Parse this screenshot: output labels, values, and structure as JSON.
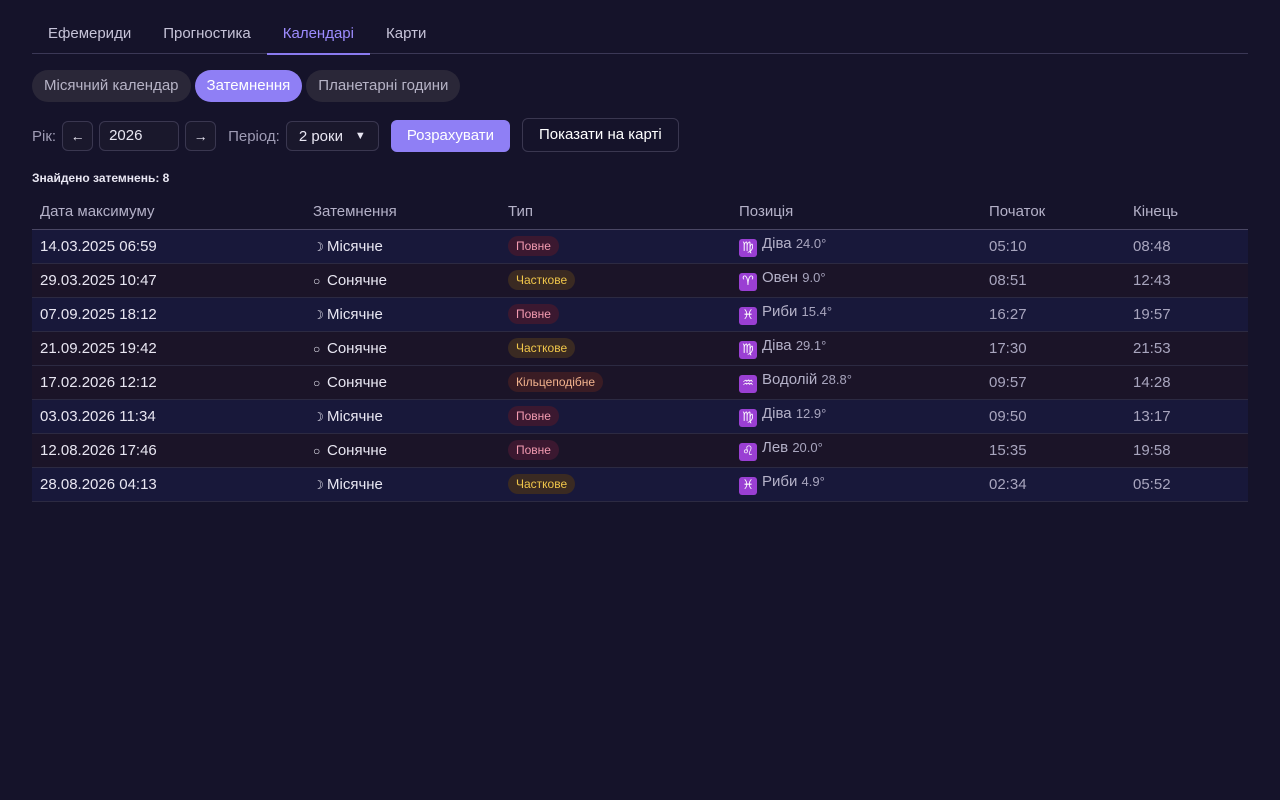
{
  "tabs": [
    {
      "label": "Ефемериди",
      "active": false
    },
    {
      "label": "Прогностика",
      "active": false
    },
    {
      "label": "Календарі",
      "active": true
    },
    {
      "label": "Карти",
      "active": false
    }
  ],
  "subtabs": [
    {
      "label": "Місячний календар",
      "active": false
    },
    {
      "label": "Затемнення",
      "active": true
    },
    {
      "label": "Планетарні години",
      "active": false
    }
  ],
  "controls": {
    "year_label": "Рік:",
    "prev_icon": "arrow-left-icon",
    "prev_glyph": "←",
    "year_value": "2026",
    "next_icon": "arrow-right-icon",
    "next_glyph": "→",
    "period_label": "Період:",
    "period_value": "2 роки",
    "calculate_label": "Розрахувати",
    "map_label": "Показати на карті"
  },
  "summary": "Знайдено затемнень: 8",
  "table": {
    "headers": [
      "Дата максимуму",
      "Затемнення",
      "Тип",
      "Позиція",
      "Початок",
      "Кінець"
    ],
    "rows": [
      {
        "date": "14.03.2025 06:59",
        "icon_glyph": "☽",
        "kind": "Місячне",
        "type": "Повне",
        "type_color": "red",
        "zodiac_icon": "virgo-icon",
        "zodiac_glyph": "♍",
        "sign": "Діва",
        "degree": "24.0°",
        "start": "05:10",
        "end": "08:48",
        "row_style": "lunar"
      },
      {
        "date": "29.03.2025 10:47",
        "icon_glyph": "○",
        "kind": "Сонячне",
        "type": "Часткове",
        "type_color": "yellow",
        "zodiac_icon": "aries-icon",
        "zodiac_glyph": "♈",
        "sign": "Овен",
        "degree": "9.0°",
        "start": "08:51",
        "end": "12:43",
        "row_style": "solar"
      },
      {
        "date": "07.09.2025 18:12",
        "icon_glyph": "☽",
        "kind": "Місячне",
        "type": "Повне",
        "type_color": "red",
        "zodiac_icon": "pisces-icon",
        "zodiac_glyph": "♓",
        "sign": "Риби",
        "degree": "15.4°",
        "start": "16:27",
        "end": "19:57",
        "row_style": "lunar"
      },
      {
        "date": "21.09.2025 19:42",
        "icon_glyph": "○",
        "kind": "Сонячне",
        "type": "Часткове",
        "type_color": "yellow",
        "zodiac_icon": "virgo-icon",
        "zodiac_glyph": "♍",
        "sign": "Діва",
        "degree": "29.1°",
        "start": "17:30",
        "end": "21:53",
        "row_style": "solar"
      },
      {
        "date": "17.02.2026 12:12",
        "icon_glyph": "○",
        "kind": "Сонячне",
        "type": "Кільцеподібне",
        "type_color": "orange",
        "zodiac_icon": "aquarius-icon",
        "zodiac_glyph": "♒",
        "sign": "Водолій",
        "degree": "28.8°",
        "start": "09:57",
        "end": "14:28",
        "row_style": "solar"
      },
      {
        "date": "03.03.2026 11:34",
        "icon_glyph": "☽",
        "kind": "Місячне",
        "type": "Повне",
        "type_color": "red",
        "zodiac_icon": "virgo-icon",
        "zodiac_glyph": "♍",
        "sign": "Діва",
        "degree": "12.9°",
        "start": "09:50",
        "end": "13:17",
        "row_style": "lunar"
      },
      {
        "date": "12.08.2026 17:46",
        "icon_glyph": "○",
        "kind": "Сонячне",
        "type": "Повне",
        "type_color": "red",
        "zodiac_icon": "leo-icon",
        "zodiac_glyph": "♌",
        "sign": "Лев",
        "degree": "20.0°",
        "start": "15:35",
        "end": "19:58",
        "row_style": "solar"
      },
      {
        "date": "28.08.2026 04:13",
        "icon_glyph": "☽",
        "kind": "Місячне",
        "type": "Часткове",
        "type_color": "yellow",
        "zodiac_icon": "pisces-icon",
        "zodiac_glyph": "♓",
        "sign": "Риби",
        "degree": "4.9°",
        "start": "02:34",
        "end": "05:52",
        "row_style": "lunar"
      }
    ]
  },
  "colors": {
    "background": "#15132a",
    "accent": "#8f7ff5",
    "badge_red": "#f39ab0",
    "badge_yellow": "#f0c64a",
    "badge_orange": "#f3b38e",
    "zodiac": "#9a3fd3"
  }
}
